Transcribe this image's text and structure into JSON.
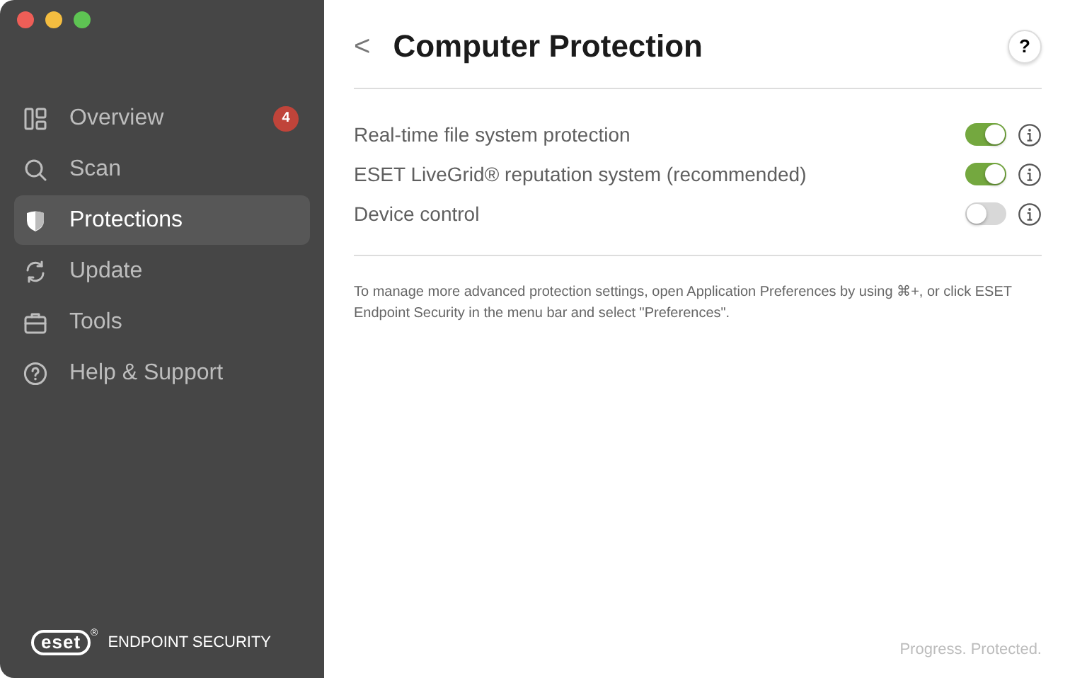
{
  "sidebar": {
    "items": [
      {
        "label": "Overview",
        "selected": false,
        "badge": "4"
      },
      {
        "label": "Scan",
        "selected": false
      },
      {
        "label": "Protections",
        "selected": true
      },
      {
        "label": "Update",
        "selected": false
      },
      {
        "label": "Tools",
        "selected": false
      },
      {
        "label": "Help & Support",
        "selected": false
      }
    ],
    "brand": {
      "logo": "eset",
      "mark": "®",
      "product": "ENDPOINT SECURITY"
    }
  },
  "header": {
    "back": "<",
    "title": "Computer Protection",
    "help": "?"
  },
  "settings": [
    {
      "label": "Real-time file system protection",
      "on": true
    },
    {
      "label": "ESET LiveGrid® reputation system (recommended)",
      "on": true
    },
    {
      "label": "Device control",
      "on": false
    }
  ],
  "note": "To manage more advanced protection settings, open Application Preferences by using ⌘+, or click ESET Endpoint Security in the menu bar and select \"Preferences\".",
  "footer": "Progress. Protected."
}
